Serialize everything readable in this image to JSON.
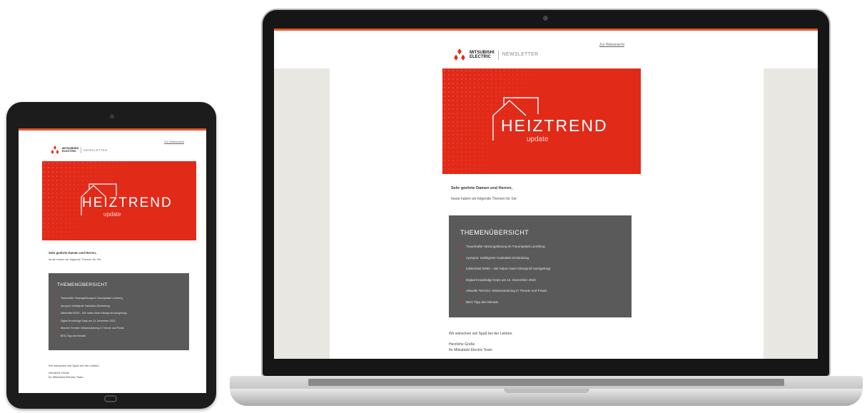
{
  "newsletter": {
    "brand_line1": "MITSUBISHI",
    "brand_line2": "ELECTRIC",
    "newsletter_label": "NEWSLETTER",
    "web_link": "Zur Webansicht",
    "hero_title": "HEIZTREND",
    "hero_subtitle": "update",
    "greeting": "Sehr geehrte Damen und Herren,",
    "intro": "heute haben wir folgende Themen für Sie:",
    "topics_heading": "THEMENÜBERSICHT",
    "topics": [
      "Traumhafte Heizungslösung im Traumpalast Leonberg",
      "Apropos: Intelligente Kaskaden-Einbindung",
      "Kältemittel R290 – Wir haben beim Klimaprofi nachgefragt",
      "Digital Knowledge Days am 14. Dezember 2023",
      "Aktuelle Termine: Wissenstraining in Theorie und Praxis",
      "BEG-Tipp des Monats"
    ],
    "closing_line": "Wir wünschen viel Spaß bei der Lektüre.",
    "regards": "Herzliche Grüße",
    "signature": "Ihr Mitsubishi Electric Team"
  },
  "colors": {
    "accent_orange": "#e3562a",
    "hero_red": "#e22a19",
    "topics_gray": "#5a5a5a",
    "side_beige": "#e9e7e2"
  }
}
